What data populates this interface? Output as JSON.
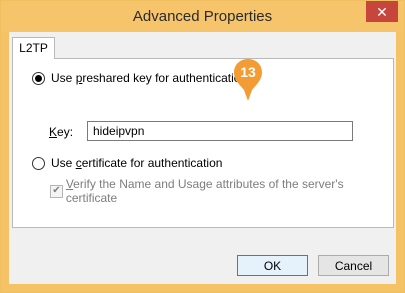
{
  "window": {
    "title": "Advanced Properties",
    "close_glyph": "✕"
  },
  "tabs": [
    {
      "label": "L2TP",
      "selected": true
    }
  ],
  "options": {
    "preshared": {
      "label_pre": "Use ",
      "label_access": "p",
      "label_post": "reshared key for authentication",
      "checked": true
    },
    "key": {
      "label_access": "K",
      "label_post": "ey:",
      "value": "hideipvpn"
    },
    "certificate": {
      "label_pre": "Use ",
      "label_access": "c",
      "label_post": "ertificate for authentication",
      "checked": false
    },
    "verify": {
      "label_access": "V",
      "label_post": "erify the Name and Usage attributes of the server's certificate",
      "checked": true,
      "enabled": false
    }
  },
  "buttons": {
    "ok": "OK",
    "cancel": "Cancel"
  },
  "annotation": {
    "number": "13",
    "color": "#f39c34"
  },
  "colors": {
    "titlebar": "#f6c46a",
    "close": "#c7463c",
    "dialog_bg": "#f0f0f0"
  }
}
